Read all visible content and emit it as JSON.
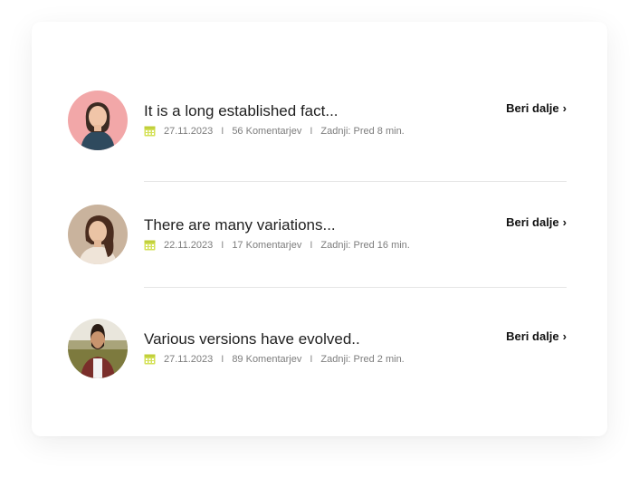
{
  "accent_color": "#d4e157",
  "posts": [
    {
      "title": "It is a long established fact...",
      "date": "27.11.2023",
      "comments": "56 Komentarjev",
      "last": "Zadnji: Pred 8 min.",
      "link": "Beri dalje",
      "link_icon": "chevron-right-icon",
      "separator": "I"
    },
    {
      "title": "There are many variations...",
      "date": "22.11.2023",
      "comments": "17 Komentarjev",
      "last": "Zadnji: Pred 16 min.",
      "link": "Beri dalje",
      "link_icon": "chevron-right-icon",
      "separator": "I"
    },
    {
      "title": "Various versions have evolved..",
      "date": "27.11.2023",
      "comments": "89 Komentarjev",
      "last": "Zadnji: Pred 2 min.",
      "link": "Beri dalje",
      "link_icon": "chevron-right-icon",
      "separator": "I"
    }
  ]
}
